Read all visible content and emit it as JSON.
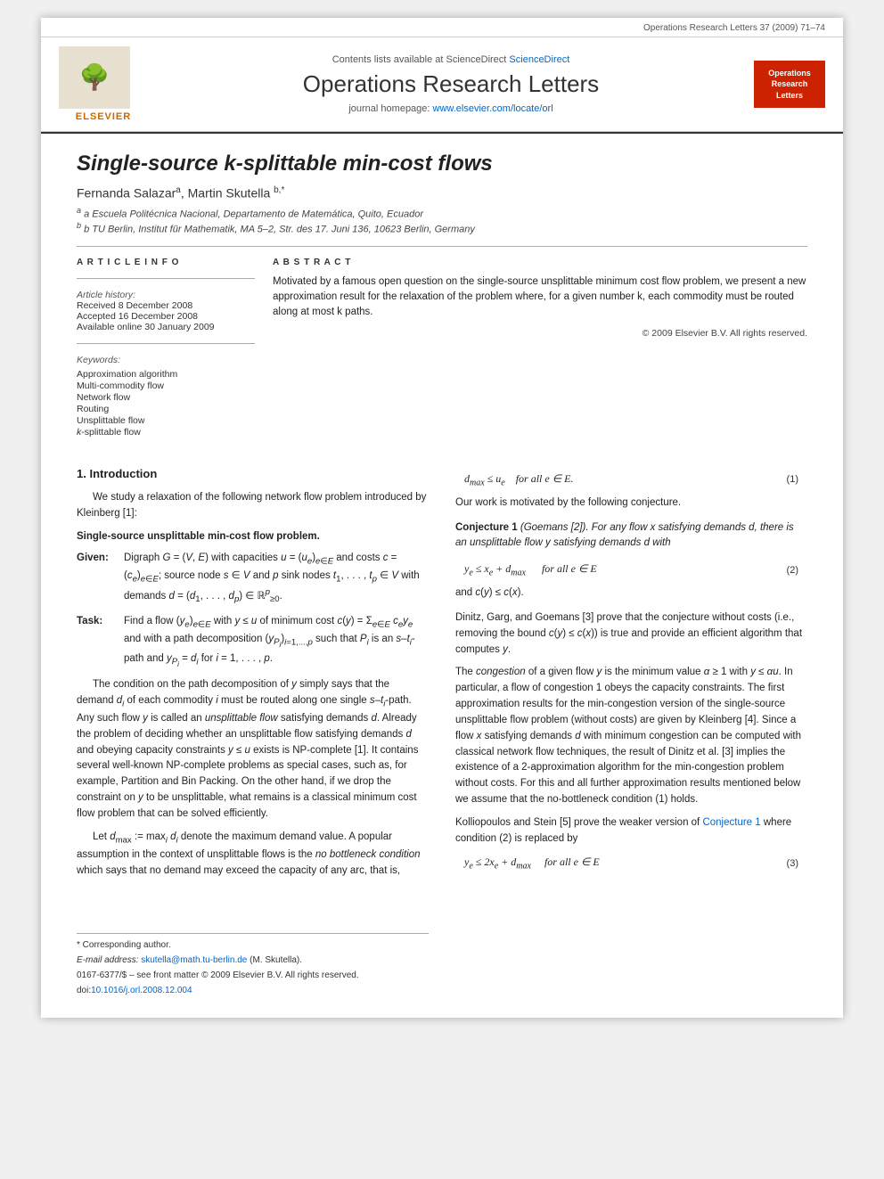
{
  "page": {
    "journal_ref": "Operations Research Letters 37 (2009) 71–74",
    "header": {
      "sciencedirect_text": "Contents lists available at ScienceDirect",
      "sciencedirect_url": "ScienceDirect",
      "journal_title": "Operations Research Letters",
      "homepage_text": "journal homepage: www.elsevier.com/locate/orl",
      "homepage_url": "www.elsevier.com/locate/orl",
      "elsevier_brand": "ELSEVIER",
      "orl_logo_lines": [
        "Operations",
        "Research",
        "Letters"
      ]
    },
    "article": {
      "title": "Single-source k-splittable min-cost flows",
      "authors": "Fernanda Salazar a, Martin Skutella b,*",
      "affiliation_a": "a Escuela Politécnica Nacional, Departamento de Matemática, Quito, Ecuador",
      "affiliation_b": "b TU Berlin, Institut für Mathematik, MA 5–2, Str. des 17. Juni 136, 10623 Berlin, Germany",
      "article_info": {
        "section_title": "A R T I C L E   I N F O",
        "history_label": "Article history:",
        "received": "Received 8 December 2008",
        "accepted": "Accepted 16 December 2008",
        "available": "Available online 30 January 2009",
        "keywords_label": "Keywords:",
        "keywords": [
          "Approximation algorithm",
          "Multi-commodity flow",
          "Network flow",
          "Routing",
          "Unsplittable flow",
          "k-splittable flow"
        ]
      },
      "abstract": {
        "section_title": "A B S T R A C T",
        "text": "Motivated by a famous open question on the single-source unsplittable minimum cost flow problem, we present a new approximation result for the relaxation of the problem where, for a given number k, each commodity must be routed along at most k paths.",
        "copyright": "© 2009 Elsevier B.V. All rights reserved."
      }
    },
    "body": {
      "left_col": {
        "section_number": "1.",
        "section_title": "Introduction",
        "para1": "We study a relaxation of the following network flow problem introduced by Kleinberg [1]:",
        "problem_title": "Single-source unsplittable min-cost flow problem.",
        "given_label": "Given:",
        "given_text": "Digraph G = (V, E) with capacities u = (u e ) e∈E and costs c = (c e ) e∈E ; source node s ∈ V and p sink nodes t 1 , . . . , t p ∈ V with demands d = (d 1 , . . . , d p ) ∈ ℝ p ≥0 .",
        "task_label": "Task:",
        "task_text": "Find a flow (y e ) e∈E with y ≤ u of minimum cost c(y) = Σ e∈E c e y e and with a path decomposition (y Pi ) i=1,...,p such that P i is an s–t i -path and y Pi = d i for i = 1, . . . , p.",
        "para2": "The condition on the path decomposition of y simply says that the demand d i of each commodity i must be routed along one single s–t i -path. Any such flow y is called an unsplittable flow satisfying demands d. Already the problem of deciding whether an unsplittable flow satisfying demands d and obeying capacity constraints y ≤ u exists is NP-complete [1]. It contains several well-known NP-complete problems as special cases, such as, for example, Partition and Bin Packing. On the other hand, if we drop the constraint on y to be unsplittable, what remains is a classical minimum cost flow problem that can be solved efficiently.",
        "para3": "Let d max := max i d i denote the maximum demand value. A popular assumption in the context of unsplittable flows is the no bottleneck condition which says that no demand may exceed the capacity of any arc, that is,"
      },
      "right_col": {
        "equation1_formula": "d max  ≤  u e     for all e ∈ E.",
        "equation1_number": "(1)",
        "para_motivated": "Our work is motivated by the following conjecture.",
        "conjecture_label": "Conjecture 1",
        "conjecture_ref": "(Goemans [2]).",
        "conjecture_text": "For any flow x satisfying demands d, there is an unsplittable flow y satisfying demands d with",
        "eq2_formula": "y e  ≤  x e + d max       for all e ∈ E",
        "eq2_number": "(2)",
        "and_text": "and c(y) ≤ c(x).",
        "para_dinitz": "Dinitz, Garg, and Goemans [3] prove that the conjecture without costs (i.e., removing the bound c(y) ≤ c(x)) is true and provide an efficient algorithm that computes y.",
        "para_congestion": "The congestion of a given flow y is the minimum value α ≥ 1 with y ≤ αu. In particular, a flow of congestion 1 obeys the capacity constraints. The first approximation results for the min-congestion version of the single-source unsplittable flow problem (without costs) are given by Kleinberg [4]. Since a flow x satisfying demands d with minimum congestion can be computed with classical network flow techniques, the result of Dinitz et al. [3] implies the existence of a 2-approximation algorithm for the min-congestion problem without costs. For this and all further approximation results mentioned below we assume that the no-bottleneck condition (1) holds.",
        "para_kolliopoulos": "Kolliopoulos and Stein [5] prove the weaker version of Conjecture 1 where condition (2) is replaced by",
        "eq3_formula": "y e  ≤  2x e + d max     for all e ∈ E",
        "eq3_number": "(3)"
      },
      "footnotes": {
        "star_note": "* Corresponding author.",
        "email_label": "E-mail address:",
        "email": "skutella@math.tu-berlin.de",
        "email_suffix": "(M. Skutella).",
        "issn_line": "0167-6377/$ – see front matter © 2009 Elsevier B.V. All rights reserved.",
        "doi_line": "doi:10.1016/j.orl.2008.12.004"
      }
    }
  }
}
